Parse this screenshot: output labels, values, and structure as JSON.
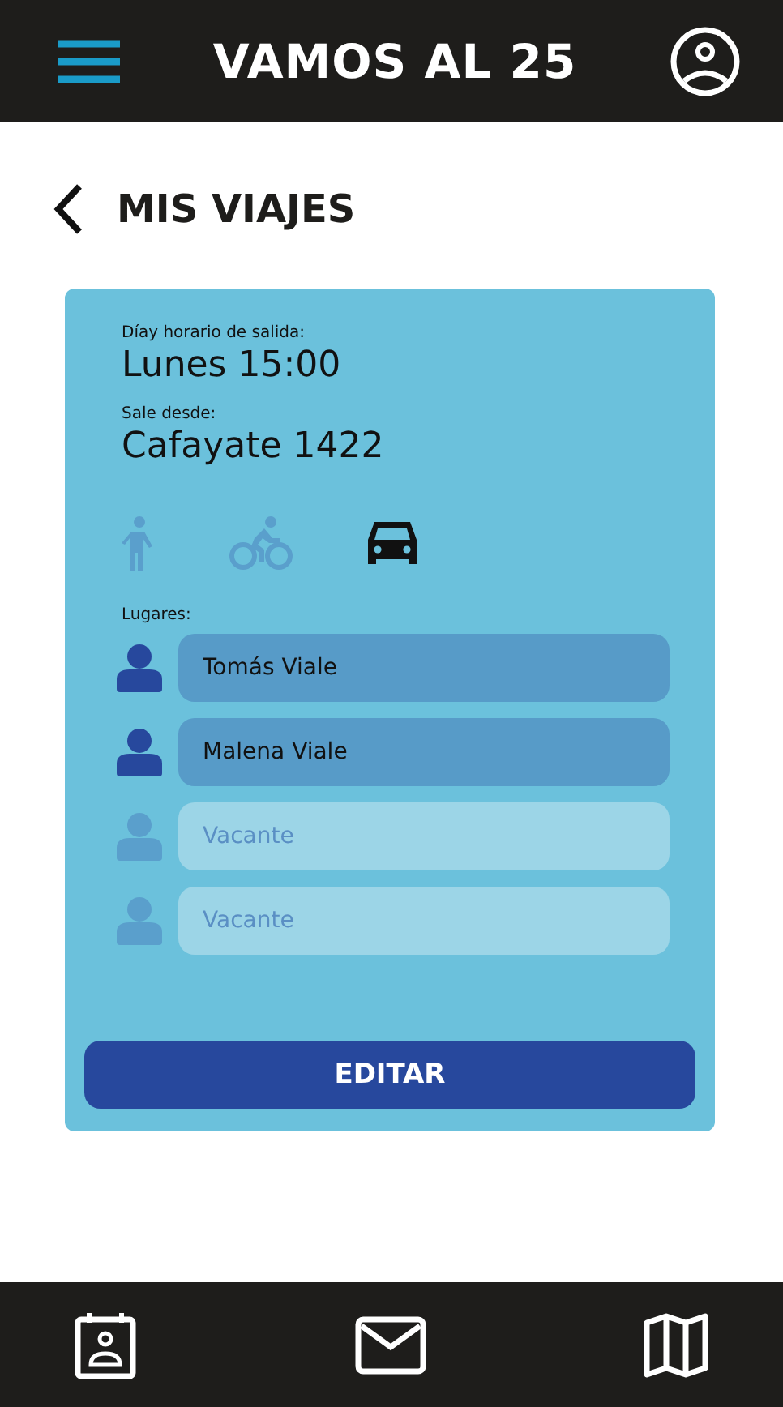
{
  "header": {
    "title": "VAMOS AL 25"
  },
  "page": {
    "title": "MIS VIAJES"
  },
  "trip": {
    "departure_label": "Díay horario de salida:",
    "departure_value": "Lunes 15:00",
    "origin_label": "Sale desde:",
    "origin_value": "Cafayate 1422",
    "modes": [
      {
        "kind": "walk",
        "selected": false
      },
      {
        "kind": "bike",
        "selected": false
      },
      {
        "kind": "car",
        "selected": true
      }
    ],
    "seats_label": "Lugares:",
    "seats": [
      {
        "occupied": true,
        "value": "Tomás Viale"
      },
      {
        "occupied": true,
        "value": "Malena Viale"
      },
      {
        "occupied": false,
        "placeholder": "Vacante"
      },
      {
        "occupied": false,
        "placeholder": "Vacante"
      }
    ],
    "button": "EDITAR"
  },
  "bottom_nav": [
    {
      "kind": "contact"
    },
    {
      "kind": "mail"
    },
    {
      "kind": "map"
    }
  ]
}
